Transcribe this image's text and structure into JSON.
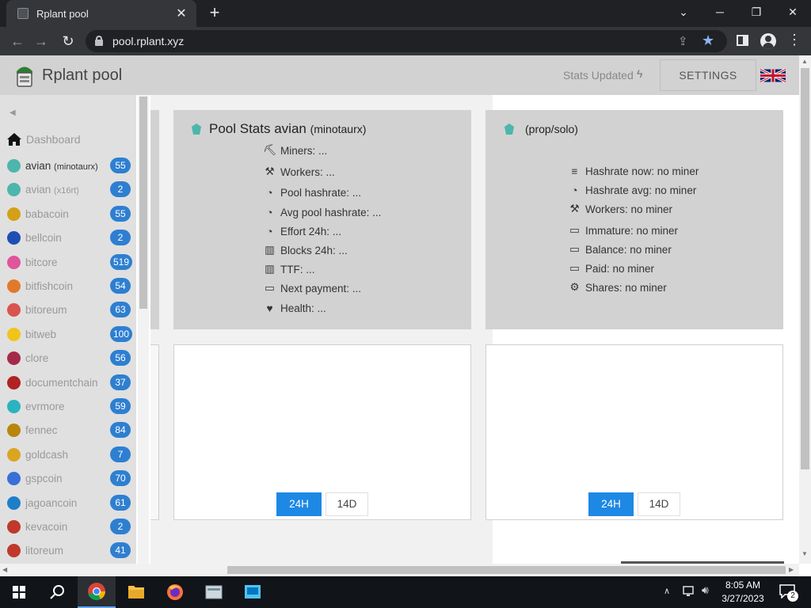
{
  "browser": {
    "tab_title": "Rplant pool",
    "tab_close": "✕",
    "new_tab": "+",
    "url": "pool.rplant.xyz",
    "win_minimize": "─",
    "win_restore": "❐",
    "win_close": "✕",
    "win_dropdown": "⌄"
  },
  "header": {
    "title": "Rplant pool",
    "stats_updated": "Stats Updated",
    "settings_label": "SETTINGS"
  },
  "sidebar": {
    "dashboard_label": "Dashboard",
    "items": [
      {
        "name": "avian",
        "algo": "(minotaurx)",
        "count": "55",
        "color": "#4db6ac",
        "active": true
      },
      {
        "name": "avian",
        "algo": "(x16rt)",
        "count": "2",
        "color": "#4db6ac",
        "active": false
      },
      {
        "name": "babacoin",
        "algo": "",
        "count": "55",
        "color": "#d4a017",
        "active": false
      },
      {
        "name": "bellcoin",
        "algo": "",
        "count": "2",
        "color": "#1e4fb3",
        "active": false
      },
      {
        "name": "bitcore",
        "algo": "",
        "count": "519",
        "color": "#e0559b",
        "active": false
      },
      {
        "name": "bitfishcoin",
        "algo": "",
        "count": "54",
        "color": "#e07a2a",
        "active": false
      },
      {
        "name": "bitoreum",
        "algo": "",
        "count": "63",
        "color": "#d9534f",
        "active": false
      },
      {
        "name": "bitweb",
        "algo": "",
        "count": "100",
        "color": "#f0c419",
        "active": false
      },
      {
        "name": "clore",
        "algo": "",
        "count": "56",
        "color": "#a52a4a",
        "active": false
      },
      {
        "name": "documentchain",
        "algo": "",
        "count": "37",
        "color": "#b22222",
        "active": false
      },
      {
        "name": "evrmore",
        "algo": "",
        "count": "59",
        "color": "#2bb3c0",
        "active": false
      },
      {
        "name": "fennec",
        "algo": "",
        "count": "84",
        "color": "#b8860b",
        "active": false
      },
      {
        "name": "goldcash",
        "algo": "",
        "count": "7",
        "color": "#daa520",
        "active": false
      },
      {
        "name": "gspcoin",
        "algo": "",
        "count": "70",
        "color": "#3a6fd8",
        "active": false
      },
      {
        "name": "jagoancoin",
        "algo": "",
        "count": "61",
        "color": "#1e7fc9",
        "active": false
      },
      {
        "name": "kevacoin",
        "algo": "",
        "count": "2",
        "color": "#c0392b",
        "active": false
      },
      {
        "name": "litoreum",
        "algo": "",
        "count": "41",
        "color": "#c0392b",
        "active": false
      }
    ]
  },
  "pool_stats": {
    "title": "Pool Stats avian",
    "subtitle": "(minotaurx)",
    "rows": [
      {
        "label": "Miners: ...",
        "icon": "miners-icon"
      },
      {
        "label": "Workers: ...",
        "icon": "workers-icon"
      },
      {
        "label": "Pool hashrate: ...",
        "icon": "gauge-icon"
      },
      {
        "label": "Avg pool hashrate: ...",
        "icon": "gauge-icon"
      },
      {
        "label": "Effort 24h: ...",
        "icon": "gauge-icon"
      },
      {
        "label": "Blocks 24h: ...",
        "icon": "bar-chart-icon"
      },
      {
        "label": "TTF: ...",
        "icon": "bar-chart-icon"
      },
      {
        "label": "Next payment: ...",
        "icon": "money-icon"
      },
      {
        "label": "Health: ...",
        "icon": "heartbeat-icon"
      }
    ]
  },
  "solo_stats": {
    "title": "(prop/solo)",
    "rows": [
      {
        "label": "Hashrate now: no miner",
        "icon": "bars-icon"
      },
      {
        "label": "Hashrate avg: no miner",
        "icon": "gauge-icon"
      },
      {
        "label": "Workers: no miner",
        "icon": "workers-icon"
      },
      {
        "label": "Immature: no miner",
        "icon": "money-icon"
      },
      {
        "label": "Balance: no miner",
        "icon": "money-icon"
      },
      {
        "label": "Paid: no miner",
        "icon": "money-icon"
      },
      {
        "label": "Shares: no miner",
        "icon": "gear-icon"
      }
    ]
  },
  "charts": {
    "left": {
      "btn_24h": "24H",
      "btn_14d": "14D"
    },
    "right": {
      "btn_24h": "24H",
      "btn_14d": "14D"
    }
  },
  "taskbar": {
    "time": "8:05 AM",
    "date": "3/27/2023",
    "notifications": "2"
  },
  "colors": {
    "accent": "#1e88e5",
    "badge": "#2e7fd1",
    "header_bg": "#d2d2d2"
  }
}
